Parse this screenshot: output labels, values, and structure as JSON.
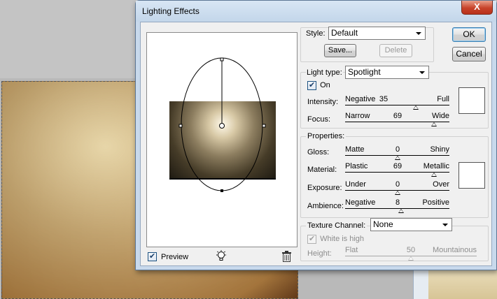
{
  "dialog": {
    "title": "Lighting Effects",
    "close_label": "X"
  },
  "buttons": {
    "ok": "OK",
    "cancel": "Cancel",
    "save": "Save...",
    "delete": "Delete"
  },
  "style": {
    "label": "Style:",
    "value": "Default"
  },
  "light_type": {
    "label": "Light type:",
    "value": "Spotlight",
    "on_label": "On",
    "on_checked": true,
    "intensity": {
      "label": "Intensity:",
      "low": "Negative",
      "value": "35",
      "high": "Full",
      "fraction": 0.68
    },
    "focus": {
      "label": "Focus:",
      "low": "Narrow",
      "value": "69",
      "high": "Wide",
      "fraction": 0.85
    }
  },
  "properties": {
    "legend": "Properties:",
    "gloss": {
      "label": "Gloss:",
      "low": "Matte",
      "value": "0",
      "high": "Shiny",
      "fraction": 0.5
    },
    "material": {
      "label": "Material:",
      "low": "Plastic",
      "value": "69",
      "high": "Metallic",
      "fraction": 0.85
    },
    "exposure": {
      "label": "Exposure:",
      "low": "Under",
      "value": "0",
      "high": "Over",
      "fraction": 0.5
    },
    "ambience": {
      "label": "Ambience:",
      "low": "Negative",
      "value": "8",
      "high": "Positive",
      "fraction": 0.54
    }
  },
  "texture": {
    "legend": "Texture Channel:",
    "value": "None",
    "white_is_high_label": "White is high",
    "white_is_high_checked": true,
    "height": {
      "label": "Height:",
      "low": "Flat",
      "value": "50",
      "high": "Mountainous",
      "fraction": 0.5
    }
  },
  "preview": {
    "label": "Preview",
    "checked": true
  },
  "icons": {
    "light": "light-bulb-icon",
    "trash": "trash-icon",
    "check": "checkmark-icon"
  },
  "colors": {
    "light_color": "#ffffff",
    "material_color": "#ffffff",
    "titlebar": "#c8d9ec",
    "close": "#c7432a"
  }
}
